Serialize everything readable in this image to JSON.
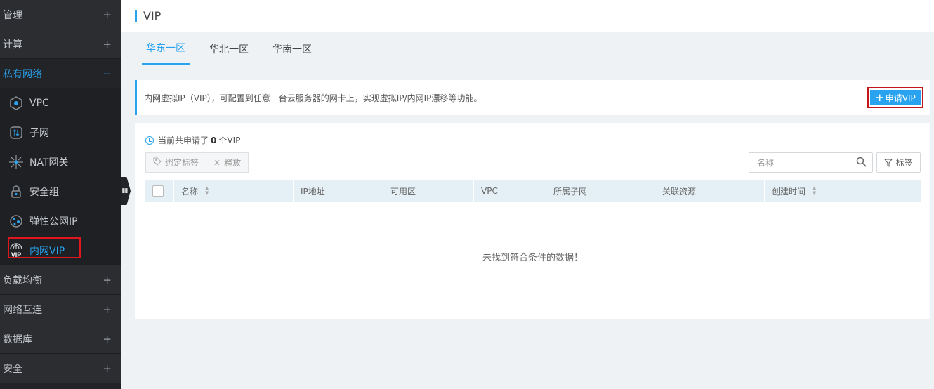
{
  "sidebar": {
    "sections_top": [
      {
        "label": "管理",
        "toggle": "+"
      },
      {
        "label": "计算",
        "toggle": "+"
      }
    ],
    "active_section": {
      "label": "私有网络",
      "toggle": "−"
    },
    "items": [
      {
        "label": "VPC",
        "icon": "vpc-icon"
      },
      {
        "label": "子网",
        "icon": "subnet-icon"
      },
      {
        "label": "NAT网关",
        "icon": "nat-gateway-icon"
      },
      {
        "label": "安全组",
        "icon": "security-group-icon"
      },
      {
        "label": "弹性公网IP",
        "icon": "eip-icon"
      },
      {
        "label": "内网VIP",
        "icon": "vip-icon"
      }
    ],
    "sections_bottom": [
      {
        "label": "负载均衡",
        "toggle": "+"
      },
      {
        "label": "网络互连",
        "toggle": "+"
      },
      {
        "label": "数据库",
        "toggle": "+"
      },
      {
        "label": "安全",
        "toggle": "+"
      }
    ]
  },
  "header": {
    "title": "VIP"
  },
  "tabs": [
    {
      "label": "华东一区"
    },
    {
      "label": "华北一区"
    },
    {
      "label": "华南一区"
    }
  ],
  "notice": {
    "text": "内网虚拟IP（VIP），可配置到任意一台云服务器的网卡上，实现虚拟IP/内网IP漂移等功能。",
    "apply_button": "申请VIP"
  },
  "panel": {
    "count_prefix": "当前共申请了",
    "count_value": "0",
    "count_suffix": "个VIP",
    "bind_tag_button": "绑定标签",
    "release_button": "释放",
    "search_placeholder": "名称",
    "tag_filter_button": "标签",
    "columns": [
      "名称",
      "IP地址",
      "可用区",
      "VPC",
      "所属子网",
      "关联资源",
      "创建时间"
    ],
    "empty_text": "未找到符合条件的数据！"
  },
  "colors": {
    "accent": "#29a3f0",
    "highlight": "#e0161f",
    "sidebar_bg": "#222427"
  }
}
